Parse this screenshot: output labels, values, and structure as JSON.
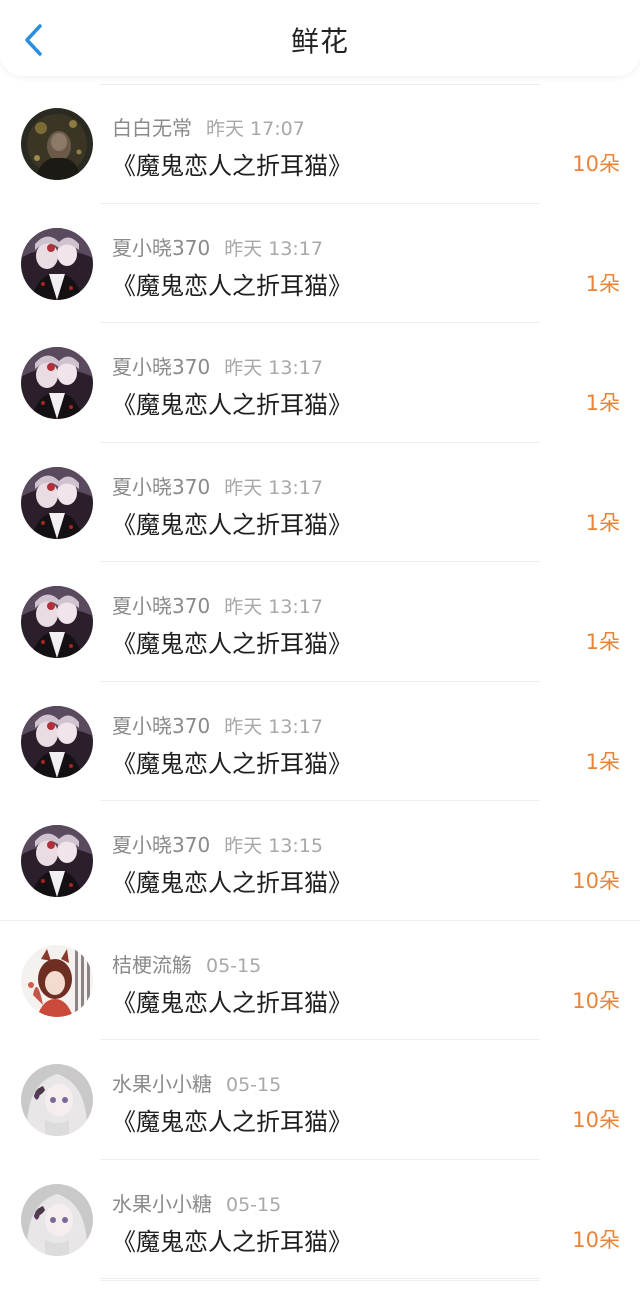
{
  "header": {
    "title": "鲜花",
    "back_icon": "chevron-left-icon",
    "accent": "#2a8fe0"
  },
  "colors": {
    "count": "#e8843a",
    "name": "#8a8a8a",
    "time": "#a8a8a8",
    "title": "#1f1f1f"
  },
  "items": [
    {
      "name": "白白无常",
      "time": "昨天 17:07",
      "title": "《魔鬼恋人之折耳猫》",
      "count": "10朵",
      "avatar": "dark"
    },
    {
      "name": "夏小晓370",
      "time": "昨天 13:17",
      "title": "《魔鬼恋人之折耳猫》",
      "count": "1朵",
      "avatar": "gothic"
    },
    {
      "name": "夏小晓370",
      "time": "昨天 13:17",
      "title": "《魔鬼恋人之折耳猫》",
      "count": "1朵",
      "avatar": "gothic"
    },
    {
      "name": "夏小晓370",
      "time": "昨天 13:17",
      "title": "《魔鬼恋人之折耳猫》",
      "count": "1朵",
      "avatar": "gothic"
    },
    {
      "name": "夏小晓370",
      "time": "昨天 13:17",
      "title": "《魔鬼恋人之折耳猫》",
      "count": "1朵",
      "avatar": "gothic"
    },
    {
      "name": "夏小晓370",
      "time": "昨天 13:17",
      "title": "《魔鬼恋人之折耳猫》",
      "count": "1朵",
      "avatar": "gothic"
    },
    {
      "name": "夏小晓370",
      "time": "昨天 13:15",
      "title": "《魔鬼恋人之折耳猫》",
      "count": "10朵",
      "avatar": "gothic"
    },
    {
      "name": "桔梗流觞",
      "time": "05-15",
      "title": "《魔鬼恋人之折耳猫》",
      "count": "10朵",
      "avatar": "redfox"
    },
    {
      "name": "水果小小糖",
      "time": "05-15",
      "title": "《魔鬼恋人之折耳猫》",
      "count": "10朵",
      "avatar": "pale"
    },
    {
      "name": "水果小小糖",
      "time": "05-15",
      "title": "《魔鬼恋人之折耳猫》",
      "count": "10朵",
      "avatar": "pale"
    }
  ]
}
